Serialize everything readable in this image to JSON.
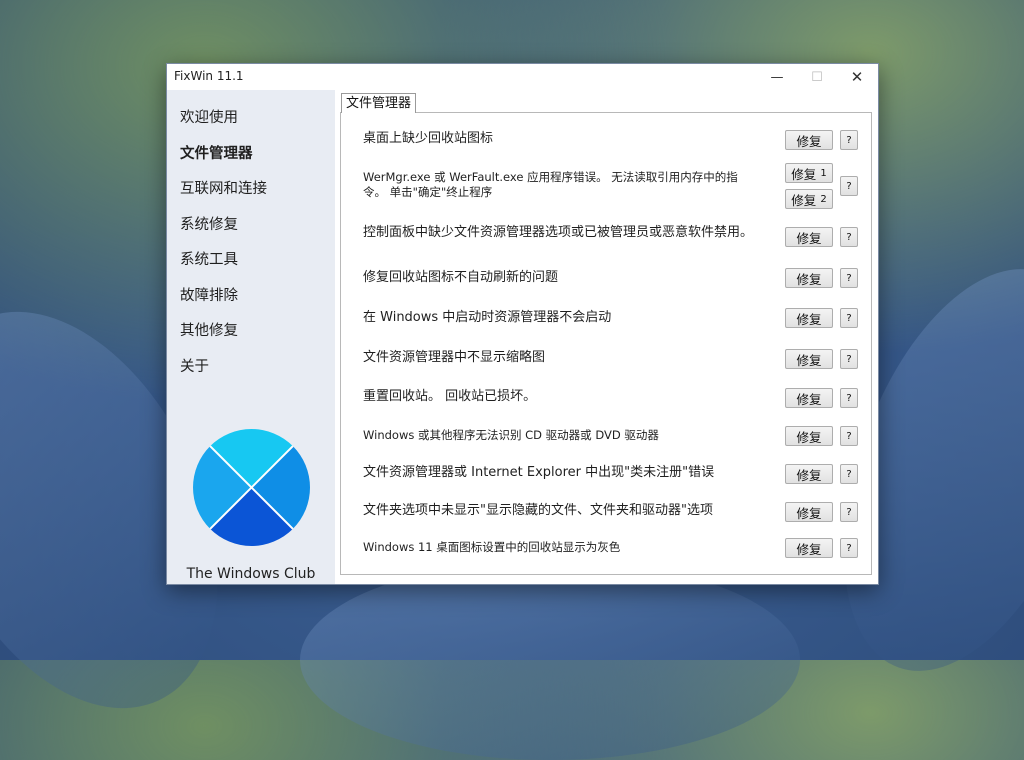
{
  "window": {
    "title": "FixWin 11.1"
  },
  "window_controls": {
    "minimize": "—",
    "maximize": "☐",
    "close": "✕"
  },
  "sidebar": {
    "items": [
      {
        "label": "欢迎使用"
      },
      {
        "label": "文件管理器",
        "active": true
      },
      {
        "label": "互联网和连接"
      },
      {
        "label": "系统修复"
      },
      {
        "label": "系统工具"
      },
      {
        "label": "故障排除"
      },
      {
        "label": "其他修复"
      },
      {
        "label": "关于"
      }
    ],
    "brand": "The Windows Club"
  },
  "tab": {
    "label": "文件管理器"
  },
  "fixes": [
    {
      "text": "桌面上缺少回收站图标",
      "button": "修复",
      "help": "?"
    },
    {
      "text": "WerMgr.exe 或 WerFault.exe 应用程序错误。 无法读取引用内存中的指令。 单击\"确定\"终止程序",
      "button1": "修复",
      "button1_num": "1",
      "button2": "修复",
      "button2_num": "2",
      "help": "?"
    },
    {
      "text": "控制面板中缺少文件资源管理器选项或已被管理员或恶意软件禁用。",
      "button": "修复",
      "help": "?"
    },
    {
      "text": "修复回收站图标不自动刷新的问题",
      "button": "修复",
      "help": "?"
    },
    {
      "text": "在 Windows 中启动时资源管理器不会启动",
      "button": "修复",
      "help": "?"
    },
    {
      "text": "文件资源管理器中不显示缩略图",
      "button": "修复",
      "help": "?"
    },
    {
      "text": "重置回收站。 回收站已损坏。",
      "button": "修复",
      "help": "?"
    },
    {
      "text": "Windows 或其他程序无法识别 CD 驱动器或 DVD 驱动器",
      "button": "修复",
      "help": "?"
    },
    {
      "text": "文件资源管理器或 Internet Explorer 中出现\"类未注册\"错误",
      "button": "修复",
      "help": "?"
    },
    {
      "text": "文件夹选项中未显示\"显示隐藏的文件、文件夹和驱动器\"选项",
      "button": "修复",
      "help": "?"
    },
    {
      "text": "Windows 11 桌面图标设置中的回收站显示为灰色",
      "button": "修复",
      "help": "?"
    }
  ],
  "colors": {
    "logo_top": "#17c8f2",
    "logo_left": "#1aa6ee",
    "logo_right": "#0f8ee6",
    "logo_bottom": "#0b55d6"
  }
}
